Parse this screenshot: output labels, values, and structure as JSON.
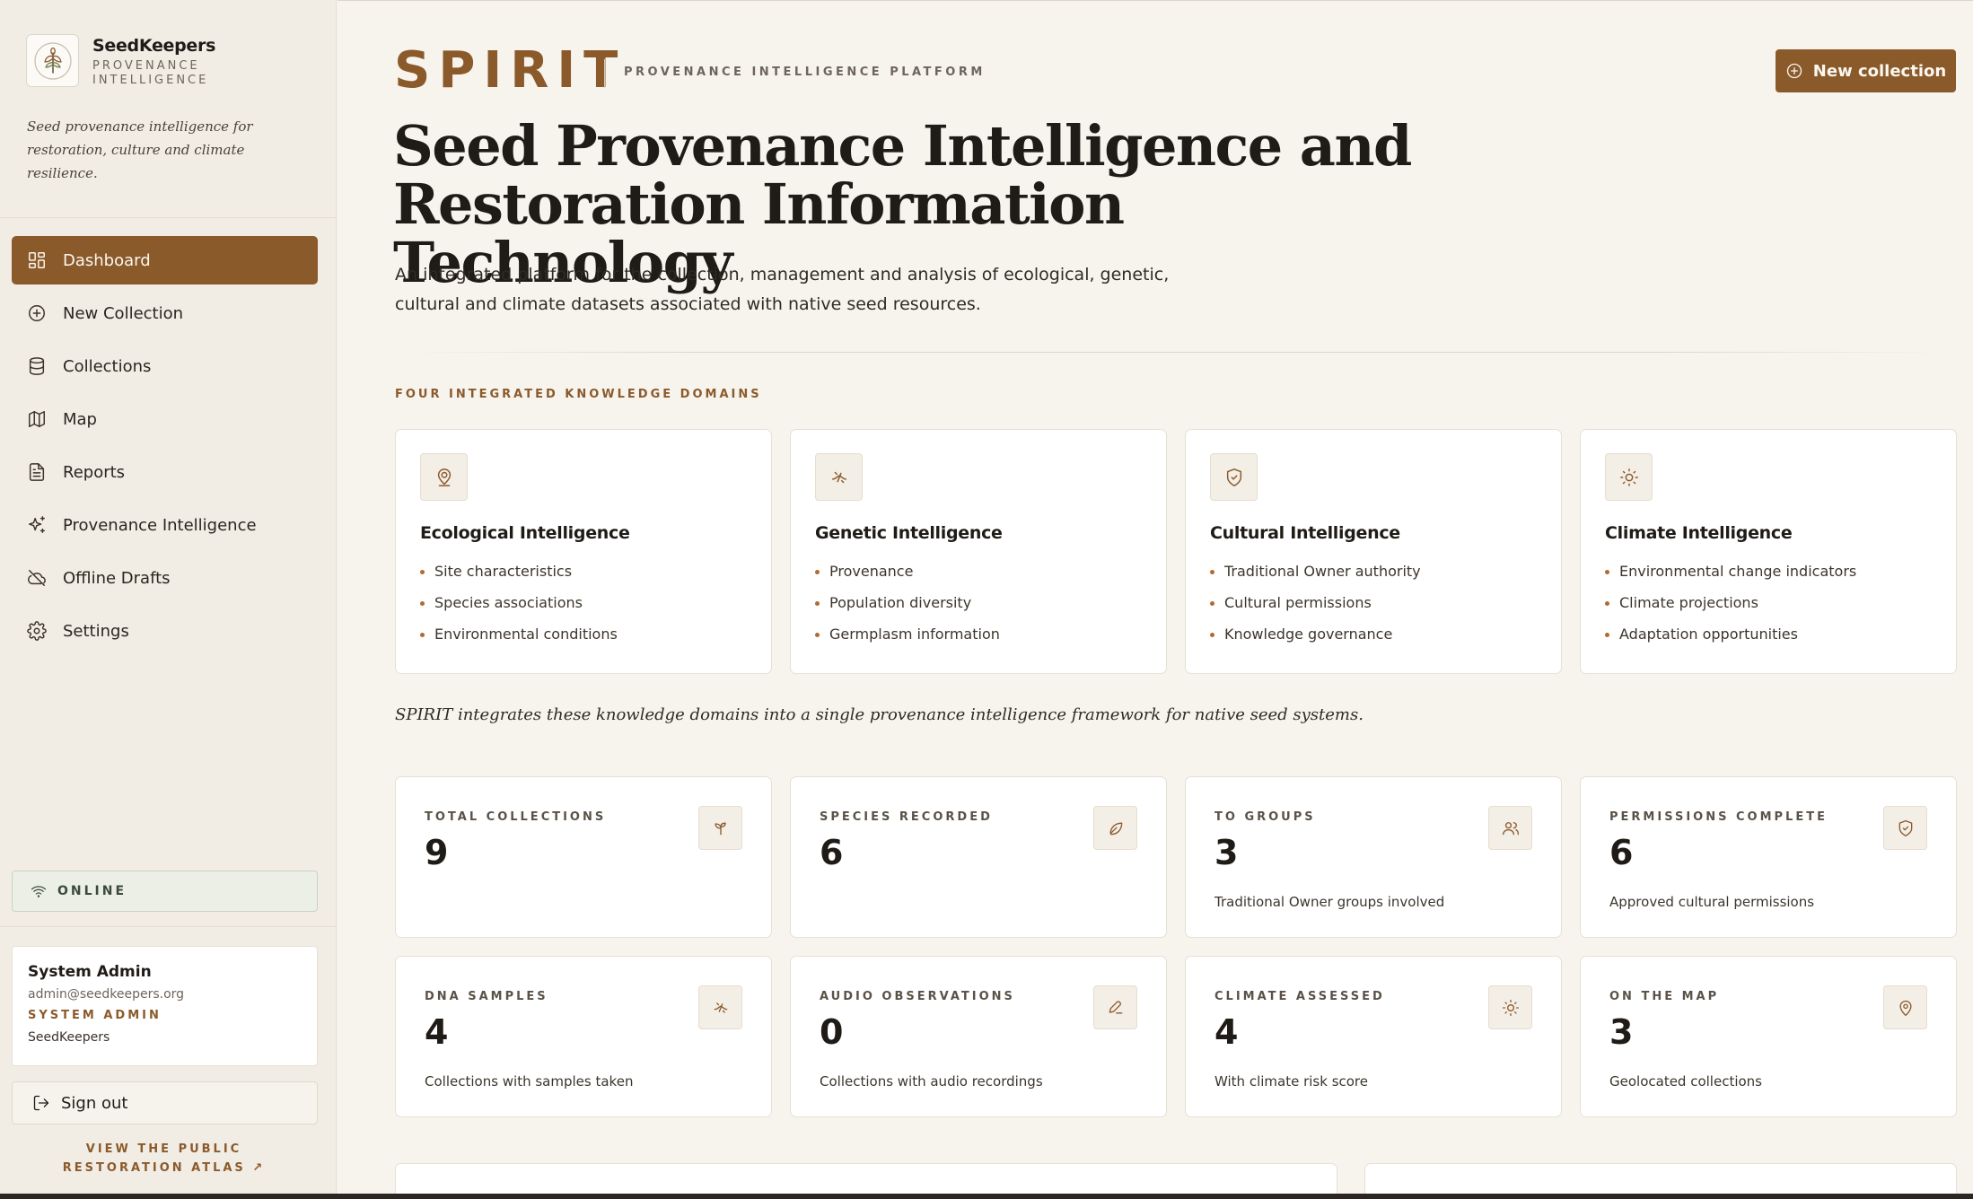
{
  "brand": {
    "name": "SeedKeepers",
    "subtitle": "PROVENANCE INTELLIGENCE",
    "tagline": "Seed provenance intelligence for restoration, culture and climate resilience."
  },
  "nav": {
    "items": [
      {
        "label": "Dashboard",
        "icon": "dashboard-icon",
        "active": true
      },
      {
        "label": "New Collection",
        "icon": "plus-circle-icon"
      },
      {
        "label": "Collections",
        "icon": "database-icon"
      },
      {
        "label": "Map",
        "icon": "map-icon"
      },
      {
        "label": "Reports",
        "icon": "document-icon"
      },
      {
        "label": "Provenance Intelligence",
        "icon": "sparkles-icon"
      },
      {
        "label": "Offline Drafts",
        "icon": "cloud-off-icon"
      },
      {
        "label": "Settings",
        "icon": "gear-icon"
      }
    ]
  },
  "status": {
    "label": "ONLINE"
  },
  "user": {
    "name": "System Admin",
    "email": "admin@seedkeepers.org",
    "role": "SYSTEM ADMIN",
    "org": "SeedKeepers"
  },
  "signout_label": "Sign out",
  "atlas_link": "VIEW THE PUBLIC RESTORATION ATLAS ↗",
  "header": {
    "logo": "SPIRIT",
    "platform": "PROVENANCE INTELLIGENCE PLATFORM",
    "new_button": "New collection"
  },
  "hero": {
    "title": "Seed Provenance Intelligence and Restoration Information Technology",
    "description": "An integrated platform for the collection, management and analysis of ecological, genetic, cultural and climate datasets associated with native seed resources."
  },
  "domains": {
    "label": "FOUR INTEGRATED KNOWLEDGE DOMAINS",
    "cards": [
      {
        "title": "Ecological Intelligence",
        "icon": "location-person-icon",
        "items": [
          "Site characteristics",
          "Species associations",
          "Environmental conditions"
        ]
      },
      {
        "title": "Genetic Intelligence",
        "icon": "dna-icon",
        "items": [
          "Provenance",
          "Population diversity",
          "Germplasm information"
        ]
      },
      {
        "title": "Cultural Intelligence",
        "icon": "shield-icon",
        "items": [
          "Traditional Owner authority",
          "Cultural permissions",
          "Knowledge governance"
        ]
      },
      {
        "title": "Climate Intelligence",
        "icon": "sun-icon",
        "items": [
          "Environmental change indicators",
          "Climate projections",
          "Adaptation opportunities"
        ]
      }
    ],
    "note": "SPIRIT integrates these knowledge domains into a single provenance intelligence framework for native seed systems."
  },
  "stats": [
    {
      "label": "TOTAL COLLECTIONS",
      "value": "9",
      "desc": "",
      "icon": "sprout-icon"
    },
    {
      "label": "SPECIES RECORDED",
      "value": "6",
      "desc": "",
      "icon": "leaf-icon"
    },
    {
      "label": "TO GROUPS",
      "value": "3",
      "desc": "Traditional Owner groups involved",
      "icon": "users-icon"
    },
    {
      "label": "PERMISSIONS COMPLETE",
      "value": "6",
      "desc": "Approved cultural permissions",
      "icon": "shield-check-icon"
    },
    {
      "label": "DNA SAMPLES",
      "value": "4",
      "desc": "Collections with samples taken",
      "icon": "dna-icon"
    },
    {
      "label": "AUDIO OBSERVATIONS",
      "value": "0",
      "desc": "Collections with audio recordings",
      "icon": "pen-icon"
    },
    {
      "label": "CLIMATE ASSESSED",
      "value": "4",
      "desc": "With climate risk score",
      "icon": "sun-icon"
    },
    {
      "label": "ON THE MAP",
      "value": "3",
      "desc": "Geolocated collections",
      "icon": "map-pin-icon"
    }
  ],
  "colors": {
    "accent": "#8b5a2b",
    "background": "#f7f4ee",
    "sidebar": "#f1ede5",
    "card": "#ffffff",
    "online": "#ebefe6"
  }
}
